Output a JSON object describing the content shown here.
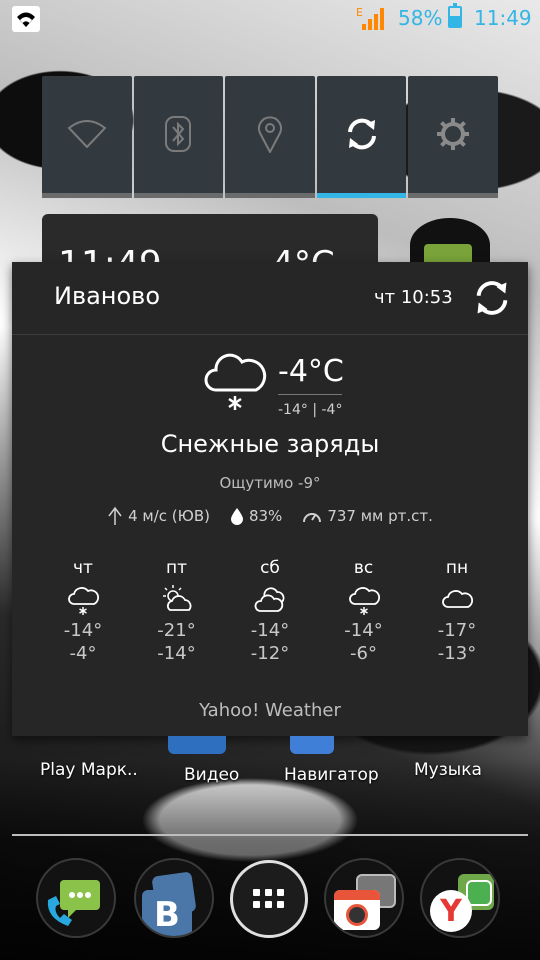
{
  "status_bar": {
    "signal_indicator": "E",
    "battery_percent": "58%",
    "battery_level": 0.58,
    "time": "11:49",
    "accent": "#33b5e5"
  },
  "quick_settings": [
    {
      "name": "wifi",
      "icon": "wifi-icon",
      "active": false
    },
    {
      "name": "bluetooth",
      "icon": "bluetooth-icon",
      "active": false
    },
    {
      "name": "location",
      "icon": "location-icon",
      "active": false
    },
    {
      "name": "sync",
      "icon": "sync-icon",
      "active": true
    },
    {
      "name": "settings",
      "icon": "gear-icon",
      "active": false
    }
  ],
  "background_widget": {
    "time": "11:49",
    "temp": "-4°C"
  },
  "weather": {
    "city": "Иваново",
    "update_time": "чт 10:53",
    "current_temp": "-4°C",
    "range": "-14° | -4°",
    "condition": "Снежные заряды",
    "feels_like": "Ощутимо -9°",
    "wind": "4 м/с (ЮВ)",
    "humidity": "83%",
    "pressure": "737 мм рт.ст.",
    "provider": "Yahoo! Weather",
    "forecast": [
      {
        "day": "чт",
        "icon": "snow-cloud-icon",
        "high": "-14°",
        "low": "-4°"
      },
      {
        "day": "пт",
        "icon": "partly-sunny-icon",
        "high": "-21°",
        "low": "-14°"
      },
      {
        "day": "сб",
        "icon": "cloudy-icon",
        "high": "-14°",
        "low": "-12°"
      },
      {
        "day": "вс",
        "icon": "snow-cloud-icon",
        "high": "-14°",
        "low": "-6°"
      },
      {
        "day": "пн",
        "icon": "cloud-icon",
        "high": "-17°",
        "low": "-13°"
      }
    ]
  },
  "home_apps": [
    {
      "label": "Play Марк..",
      "icon": "play-market-icon"
    },
    {
      "label": "Видео",
      "icon": "video-icon"
    },
    {
      "label": "Навигатор",
      "icon": "navigator-icon"
    },
    {
      "label": "Музыка",
      "icon": "music-icon"
    }
  ],
  "dock": [
    {
      "name": "phone",
      "icon": "phone-icon"
    },
    {
      "name": "vk",
      "icon": "vk-icon",
      "text": "B"
    },
    {
      "name": "app-drawer",
      "icon": "app-drawer-icon"
    },
    {
      "name": "camera",
      "icon": "camera-icon"
    },
    {
      "name": "yandex",
      "icon": "yandex-browser-icon",
      "text": "Y"
    }
  ]
}
